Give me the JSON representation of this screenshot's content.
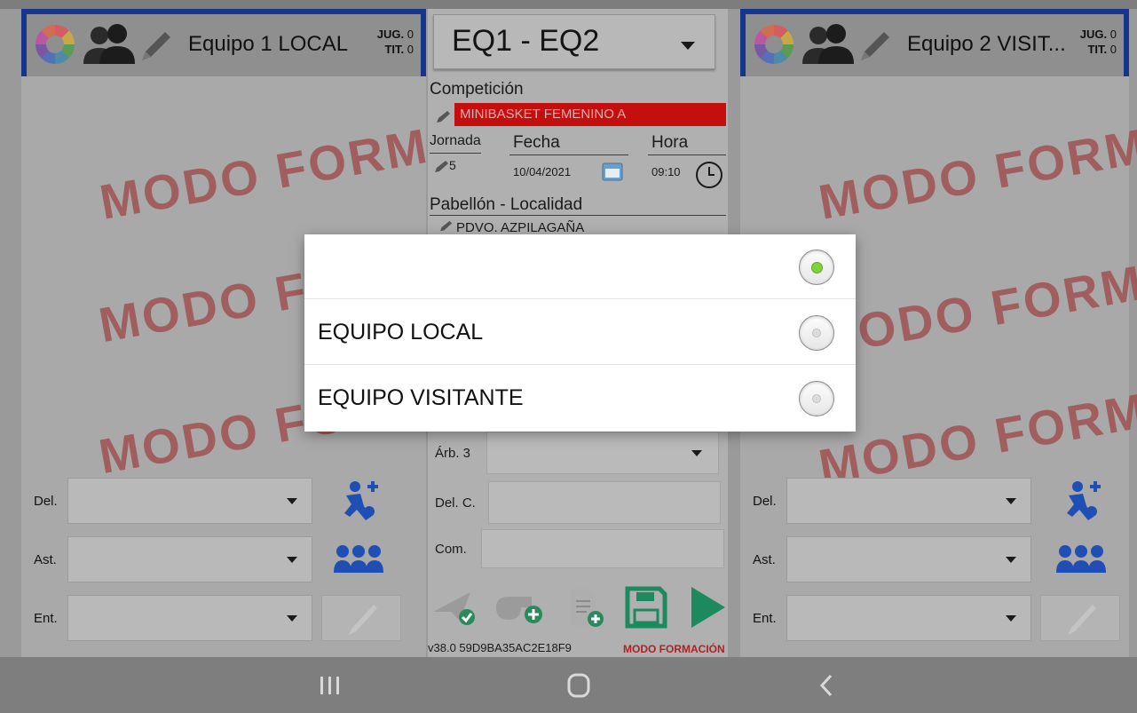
{
  "left_team": {
    "name": "Equipo 1 LOCAL",
    "jug_label": "JUG.",
    "jug_value": "0",
    "tit_label": "TIT.",
    "tit_value": "0"
  },
  "right_team": {
    "name": "Equipo 2 VISIT...",
    "jug_label": "JUG.",
    "jug_value": "0",
    "tit_label": "TIT.",
    "tit_value": "0"
  },
  "watermark_text": "MODO FORMA",
  "watermark_short": "MODO FO",
  "watermark_short_right": "ODO FORMA",
  "staff_labels": {
    "delegate": "Del.",
    "assistant": "Ast.",
    "coach": "Ent."
  },
  "center": {
    "match_selector_value": "EQ1 - EQ2",
    "competition_label": "Competición",
    "competition_value": "MINIBASKET FEMENINO A",
    "jornada_label": "Jornada",
    "jornada_value": "5",
    "fecha_label": "Fecha",
    "fecha_value": "10/04/2021",
    "hora_label": "Hora",
    "hora_value": "09:10",
    "pabellon_label": "Pabellón - Localidad",
    "pabellon_value": "PDVO. AZPILAGAÑA",
    "arb3_label": "Árb. 3",
    "delc_label": "Del. C.",
    "com_label": "Com.",
    "version": "v38.0  59D9BA35AC2E18F9",
    "mode_label": "MODO FORMACIÓN"
  },
  "dialog": {
    "options": [
      {
        "label": "",
        "selected": true
      },
      {
        "label": "EQUIPO LOCAL",
        "selected": false
      },
      {
        "label": "EQUIPO VISITANTE",
        "selected": false
      }
    ]
  },
  "colors": {
    "team_header_border": "#16358e",
    "competition_bar": "#c50f0f",
    "watermark": "#9e4a4a",
    "radio_selected": "#7ed33b",
    "player_icon_blue": "#1f4fb5",
    "save_icon": "#1c8a5e",
    "play_icon": "#1c8a5e"
  },
  "icons": {
    "team_header": [
      "color-wheel-icon",
      "people-icon",
      "pencil-icon"
    ],
    "left_side": [
      "add-player-icon",
      "group-icon",
      "pencil-icon"
    ],
    "toolbar": [
      "send-check-icon",
      "whistle-add-icon",
      "document-add-icon",
      "save-icon",
      "play-icon"
    ],
    "navbar": [
      "recents-icon",
      "home-icon",
      "back-icon"
    ]
  }
}
